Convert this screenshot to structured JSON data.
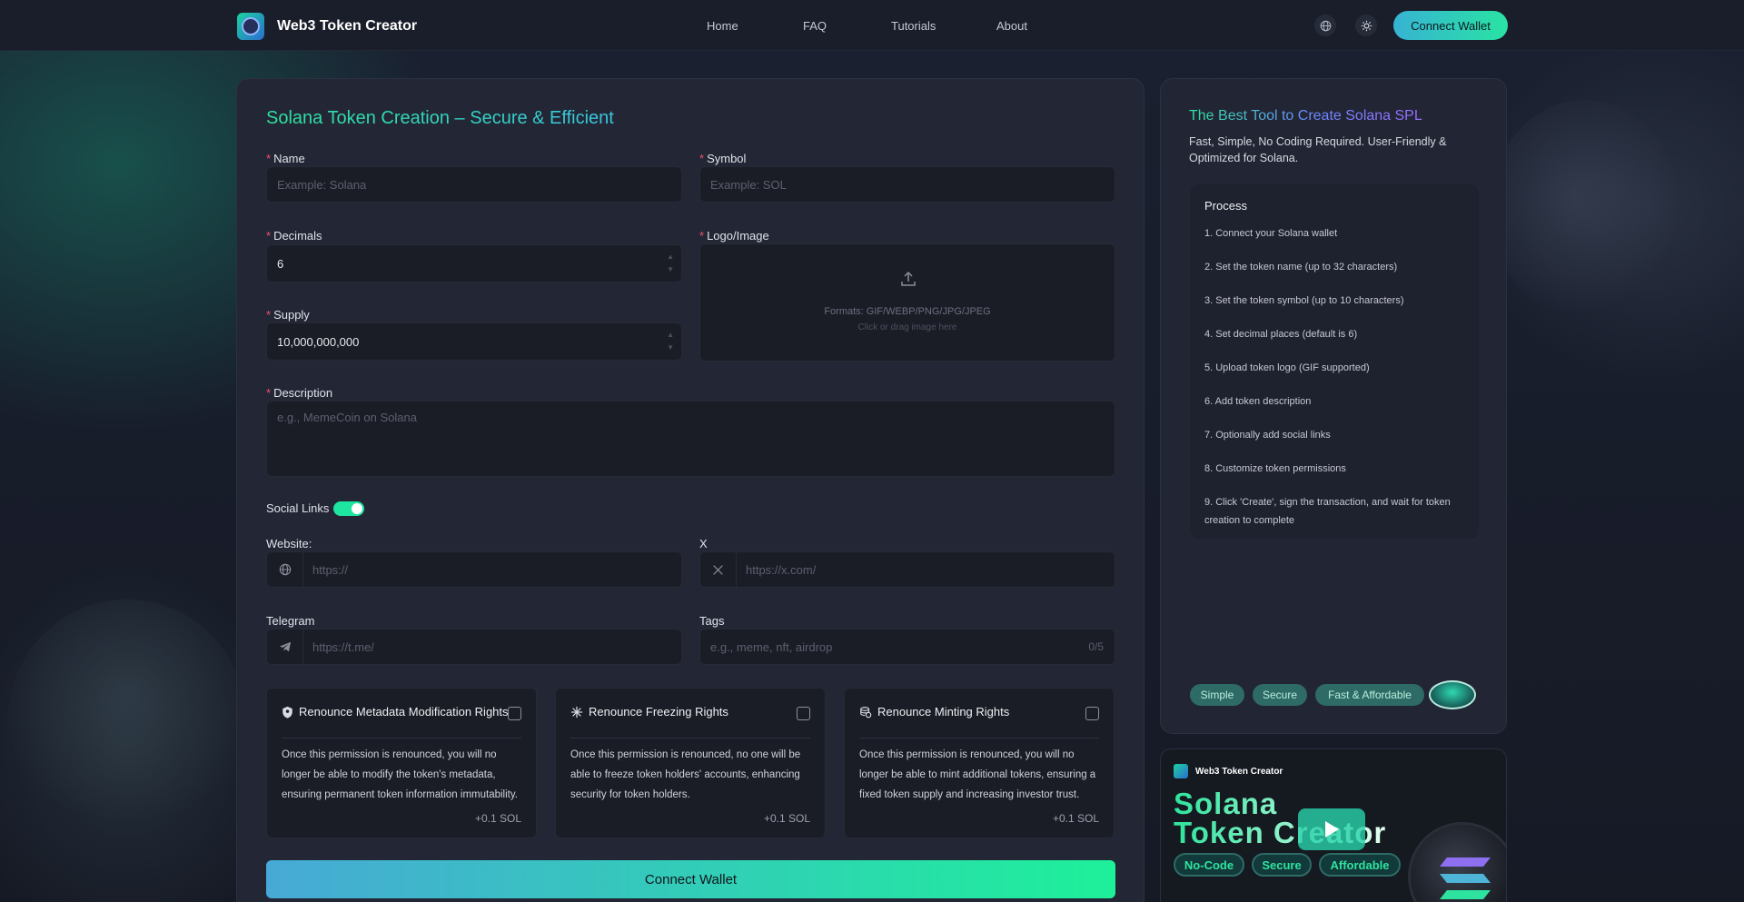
{
  "header": {
    "brand": "Web3 Token Creator",
    "nav": [
      "Home",
      "FAQ",
      "Tutorials",
      "About"
    ],
    "language_icon": "globe-icon",
    "theme_icon": "sun-icon",
    "connect_label": "Connect Wallet"
  },
  "form": {
    "title": "Solana Token Creation – Secure & Efficient",
    "name": {
      "label": "Name",
      "placeholder": "Example: Solana",
      "value": ""
    },
    "symbol": {
      "label": "Symbol",
      "placeholder": "Example: SOL",
      "value": ""
    },
    "decimals": {
      "label": "Decimals",
      "value": "6"
    },
    "logo": {
      "label": "Logo/Image",
      "formats": "Formats: GIF/WEBP/PNG/JPG/JPEG",
      "hint": "Click or drag image here"
    },
    "supply": {
      "label": "Supply",
      "value": "10,000,000,000"
    },
    "description": {
      "label": "Description",
      "placeholder": "e.g., MemeCoin on Solana"
    },
    "social": {
      "label": "Social Links",
      "enabled": true,
      "website": {
        "label": "Website:",
        "placeholder": "https://"
      },
      "x": {
        "label": "X",
        "placeholder": "https://x.com/"
      },
      "telegram": {
        "label": "Telegram",
        "placeholder": "https://t.me/"
      },
      "tags": {
        "label": "Tags",
        "placeholder": "e.g., meme, nft, airdrop",
        "counter": "0/5"
      }
    },
    "permissions": [
      {
        "title": "Renounce Metadata Modification Rights",
        "icon": "shield-icon",
        "description": "Once this permission is renounced, you will no longer be able to modify the token's metadata, ensuring permanent token information immutability.",
        "fee": "+0.1 SOL",
        "checked": false
      },
      {
        "title": "Renounce Freezing Rights",
        "icon": "snowflake-icon",
        "description": "Once this permission is renounced, no one will be able to freeze token holders' accounts, enhancing security for token holders.",
        "fee": "+0.1 SOL",
        "checked": false
      },
      {
        "title": "Renounce Minting Rights",
        "icon": "coins-icon",
        "description": "Once this permission is renounced, you will no longer be able to mint additional tokens, ensuring a fixed token supply and increasing investor trust.",
        "fee": "+0.1 SOL",
        "checked": false
      }
    ],
    "submit_label": "Connect Wallet"
  },
  "sidebar": {
    "title": "The Best Tool to Create Solana SPL",
    "subtitle": "Fast, Simple, No Coding Required. User-Friendly & Optimized for Solana.",
    "process_title": "Process",
    "steps": [
      "1. Connect your Solana wallet",
      "2. Set the token name (up to 32 characters)",
      "3. Set the token symbol (up to 10 characters)",
      "4. Set decimal places (default is 6)",
      "5. Upload token logo (GIF supported)",
      "6. Add token description",
      "7. Optionally add social links",
      "8. Customize token permissions",
      "9. Click 'Create', sign the transaction, and wait for token creation to complete"
    ],
    "pills": [
      "Simple",
      "Secure",
      "Fast & Affordable"
    ]
  },
  "promo": {
    "brand": "Web3 Token Creator",
    "headline_1": "Solana",
    "headline_2": "Token Creator",
    "tags": [
      "No-Code",
      "Secure",
      "Affordable"
    ],
    "play_icon": "play-icon"
  },
  "colors": {
    "accent_green": "#1ee59f",
    "accent_cyan": "#37b3d3",
    "background": "#171b26",
    "panel": "#232735",
    "input": "#1b1d26",
    "required": "#f0506e"
  }
}
